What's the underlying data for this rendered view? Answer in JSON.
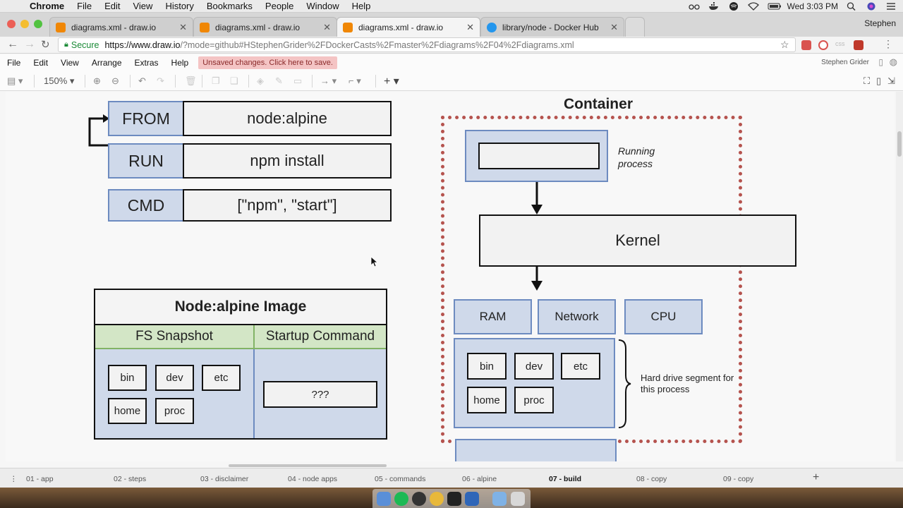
{
  "menubar": {
    "app": "Chrome",
    "items": [
      "File",
      "Edit",
      "View",
      "History",
      "Bookmarks",
      "People",
      "Window",
      "Help"
    ],
    "clock": "Wed 3:03 PM"
  },
  "tabs": [
    {
      "title": "diagrams.xml - draw.io",
      "favicon_color": "#f08705"
    },
    {
      "title": "diagrams.xml - draw.io",
      "favicon_color": "#f08705"
    },
    {
      "title": "diagrams.xml - draw.io",
      "favicon_color": "#f08705",
      "active": true
    },
    {
      "title": "library/node - Docker Hub",
      "favicon_color": "#2496ed"
    }
  ],
  "profile_name": "Stephen",
  "address": {
    "secure_label": "Secure",
    "host": "https://www.draw.io",
    "path": "/?mode=github#HStephenGrider%2FDockerCasts%2Fmaster%2Fdiagrams%2F04%2Fdiagrams.xml"
  },
  "drawio_menu": {
    "items": [
      "File",
      "Edit",
      "View",
      "Arrange",
      "Extras",
      "Help"
    ],
    "unsaved": "Unsaved changes. Click here to save.",
    "user": "Stephen Grider"
  },
  "toolbar": {
    "zoom": "150%"
  },
  "diagram": {
    "dockerfile": {
      "instructions": [
        {
          "keyword": "FROM",
          "value": "node:alpine"
        },
        {
          "keyword": "RUN",
          "value": "npm install"
        },
        {
          "keyword": "CMD",
          "value": "[\"npm\", \"start\"]"
        }
      ]
    },
    "image": {
      "title": "Node:alpine Image",
      "fs_header": "FS Snapshot",
      "cmd_header": "Startup Command",
      "folders": [
        "bin",
        "dev",
        "etc",
        "home",
        "proc"
      ],
      "command": "???"
    },
    "container": {
      "title": "Container",
      "running_label": "Running process",
      "kernel": "Kernel",
      "resources": [
        "RAM",
        "Network",
        "CPU"
      ],
      "folders": [
        "bin",
        "dev",
        "etc",
        "home",
        "proc"
      ],
      "hd_label": "Hard drive segment for this process"
    }
  },
  "pages": [
    {
      "label": "01 - app"
    },
    {
      "label": "02 - steps"
    },
    {
      "label": "03 - disclaimer"
    },
    {
      "label": "04 - node apps"
    },
    {
      "label": "05 - commands"
    },
    {
      "label": "06 - alpine"
    },
    {
      "label": "07 - build",
      "active": true
    },
    {
      "label": "08 - copy"
    },
    {
      "label": "09 - copy"
    }
  ],
  "colors": {
    "block_fill": "#cfd9ea",
    "block_border": "#6d8bc0",
    "header_green": "#d3e6c6",
    "container_dash": "#b5534e"
  }
}
